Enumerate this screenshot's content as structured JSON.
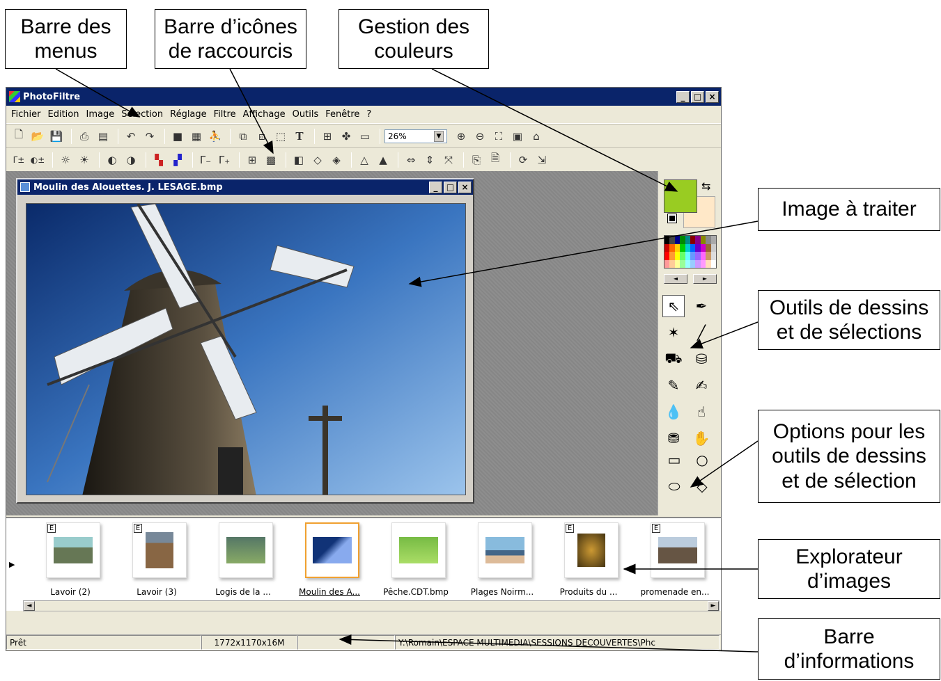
{
  "callouts": {
    "menus": "Barre des\nmenus",
    "shortcuts": "Barre d’icônes\nde raccourcis",
    "colors": "Gestion des\ncouleurs",
    "image": "Image à traiter",
    "tools": "Outils de dessins\net de sélections",
    "options": "Options pour les\noutils de dessins\net de sélection",
    "explorer": "Explorateur\nd’images",
    "info": "Barre\nd’informations"
  },
  "app": {
    "title": "PhotoFiltre",
    "menu": [
      "Fichier",
      "Edition",
      "Image",
      "Sélection",
      "Réglage",
      "Filtre",
      "Affichage",
      "Outils",
      "Fenêtre",
      "?"
    ],
    "zoom": "26%"
  },
  "document": {
    "title": "Moulin des Alouettes. J. LESAGE.bmp"
  },
  "colors": {
    "foreground": "#99cc22",
    "background": "#ffe8c8"
  },
  "explorer": {
    "thumbnails": [
      {
        "label": "Lavoir (2)",
        "badge": "E"
      },
      {
        "label": "Lavoir (3)",
        "badge": "E"
      },
      {
        "label": "Logis de la ...",
        "badge": ""
      },
      {
        "label": "Moulin des A...",
        "badge": ""
      },
      {
        "label": "Pêche.CDT.bmp",
        "badge": ""
      },
      {
        "label": "Plages Noirm...",
        "badge": ""
      },
      {
        "label": "Produits du ...",
        "badge": "E"
      },
      {
        "label": "promenade en...",
        "badge": "E"
      }
    ]
  },
  "status": {
    "state": "Prêt",
    "size": "1772x1170x16M",
    "path": "Y:\\Romain\\ESPACE MULTIMEDIA\\SESSIONS DECOUVERTES\\Phc"
  }
}
